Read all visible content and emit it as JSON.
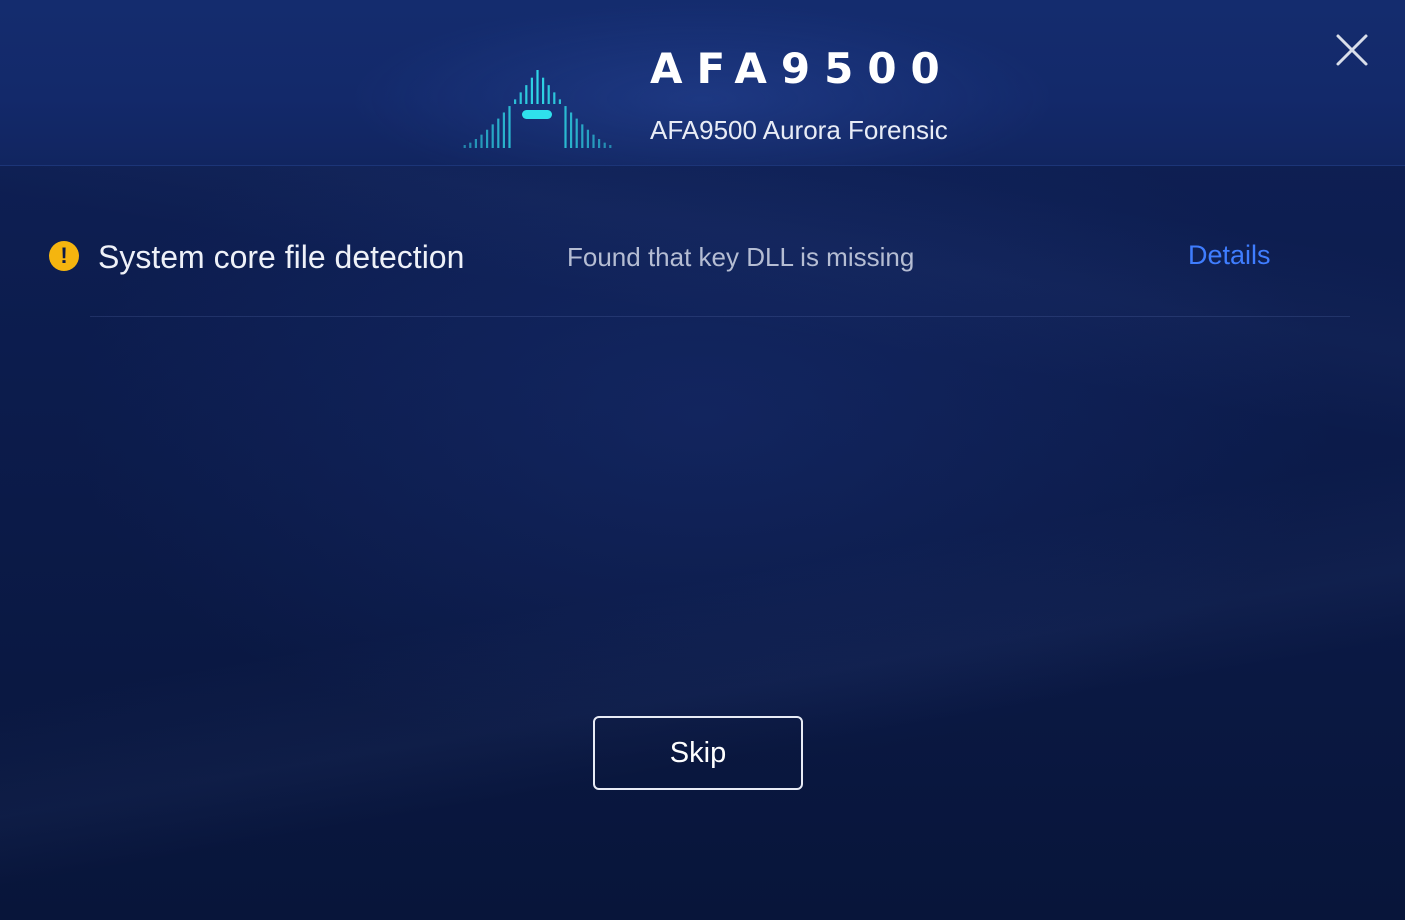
{
  "header": {
    "title": "AFA9500",
    "subtitle": "AFA9500 Aurora Forensic",
    "logo_icon": "signal-bars-logo-icon",
    "close_icon": "close-icon"
  },
  "check": {
    "status_icon": "warning-icon",
    "status_symbol": "!",
    "label": "System core file detection",
    "result": "Found that key DLL is missing",
    "details_label": "Details"
  },
  "actions": {
    "skip_label": "Skip"
  },
  "colors": {
    "background": "#0b1a45",
    "header": "#13296a",
    "accent_cyan": "#2fd6e6",
    "warning": "#f5b50f",
    "link": "#3f7dff"
  }
}
